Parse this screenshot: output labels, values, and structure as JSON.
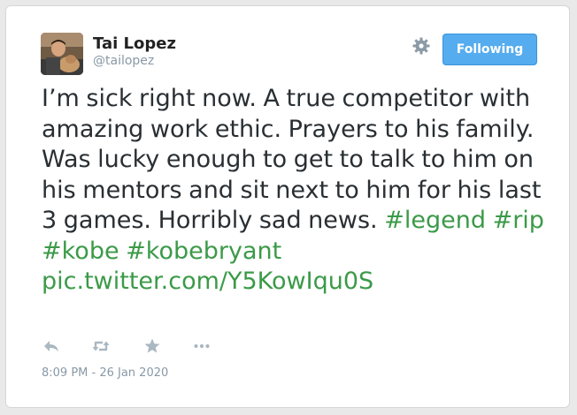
{
  "author": {
    "name": "Tai Lopez",
    "handle": "@tailopez"
  },
  "follow_button": {
    "label": "Following"
  },
  "tweet": {
    "text_plain": "I’m sick right now. A true competitor with amazing work ethic. Prayers to his family. Was lucky enough to get to talk to him on his mentors and sit next to him for his last 3 games. Horribly sad news.",
    "hashtags": [
      "#legend",
      "#rip",
      "#kobe",
      "#kobebryant"
    ],
    "link": "pic.twitter.com/Y5KowIqu0S",
    "timestamp": "8:09 PM - 26 Jan 2020"
  },
  "actions": [
    {
      "icon": "reply-icon"
    },
    {
      "icon": "retweet-icon"
    },
    {
      "icon": "like-star-icon"
    },
    {
      "icon": "more-dots-icon"
    }
  ],
  "colors": {
    "hashtag": "#3b9a48",
    "button": "#55acee",
    "muted": "#8899a6",
    "text": "#292f33"
  }
}
